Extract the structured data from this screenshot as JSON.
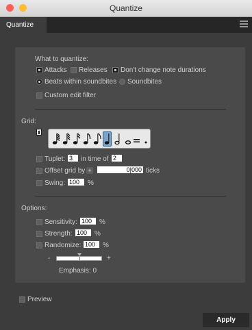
{
  "window": {
    "title": "Quantize"
  },
  "tab": {
    "label": "Quantize"
  },
  "what": {
    "title": "What to quantize:",
    "attacks": {
      "label": "Attacks",
      "checked": true
    },
    "releases": {
      "label": "Releases",
      "checked": false
    },
    "keep_durations": {
      "label": "Don't change note durations",
      "checked": true
    },
    "beats_within": {
      "label": "Beats within soundbites",
      "selected": true
    },
    "soundbites": {
      "label": "Soundbites",
      "selected": false
    },
    "custom_filter": {
      "label": "Custom edit filter",
      "checked": false
    }
  },
  "grid": {
    "title": "Grid:",
    "notes": [
      "sixty-fourth",
      "thirty-second",
      "sixteenth",
      "eighth",
      "quarter",
      "half",
      "whole",
      "double-whole",
      "dot"
    ],
    "selected_note": "quarter",
    "tuplet": {
      "label": "Tuplet:",
      "value": "3",
      "middle": "in time of",
      "value2": "2",
      "checked": false
    },
    "offset": {
      "label": "Offset grid by",
      "value": "0|000",
      "unit": "ticks",
      "checked": false
    },
    "swing": {
      "label": "Swing:",
      "value": "100",
      "unit": "%",
      "checked": false
    }
  },
  "options": {
    "title": "Options:",
    "sensitivity": {
      "label": "Sensitivity:",
      "value": "100",
      "unit": "%",
      "checked": false
    },
    "strength": {
      "label": "Strength:",
      "value": "100",
      "unit": "%",
      "checked": false
    },
    "randomize": {
      "label": "Randomize:",
      "value": "100",
      "unit": "%",
      "checked": false
    },
    "emphasis": {
      "minus": "-",
      "plus": "+",
      "label": "Emphasis: 0",
      "value": 0.5
    }
  },
  "preview": {
    "label": "Preview",
    "checked": false
  },
  "apply": {
    "label": "Apply"
  },
  "colors": {
    "close": "#fe5f57",
    "minimize": "#febc2e",
    "selected_note": "#7ea3c6"
  }
}
